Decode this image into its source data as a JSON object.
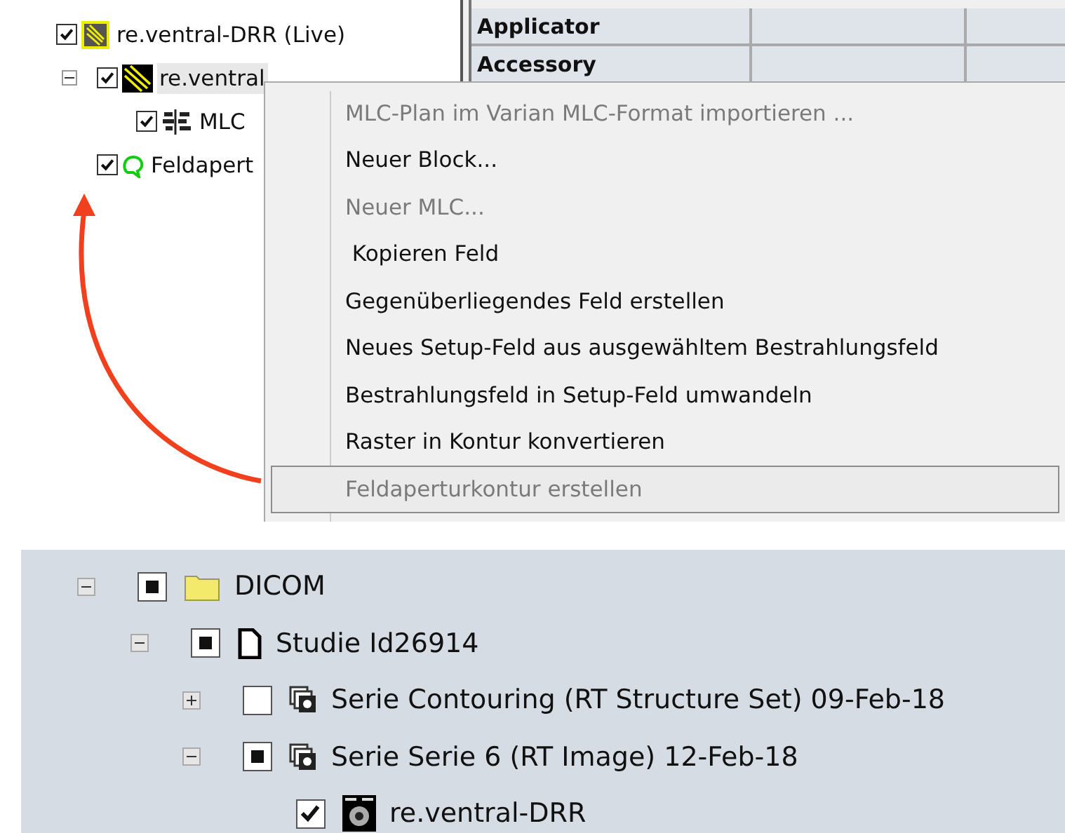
{
  "field_tree": [
    {
      "label": "re.ventral-DRR (Live)",
      "kind": "drr",
      "checked": true,
      "selected": false,
      "children": [
        {
          "label": "re.ventral",
          "kind": "field",
          "checked": true,
          "selected": true,
          "expanded": true,
          "children": [
            {
              "label": "MLC",
              "kind": "mlc",
              "checked": true,
              "selected": false
            }
          ]
        },
        {
          "label": "Feldapert",
          "kind": "aperture",
          "checked": true,
          "selected": false
        }
      ]
    }
  ],
  "properties_grid": {
    "rows": [
      {
        "label": "Applicator"
      },
      {
        "label": "Accessory"
      }
    ]
  },
  "context_menu": {
    "items": [
      {
        "label": "MLC-Plan im Varian MLC-Format importieren ...",
        "disabled": true,
        "selected": false
      },
      {
        "label": "Neuer Block...",
        "disabled": false,
        "selected": false
      },
      {
        "label": "Neuer MLC...",
        "disabled": true,
        "selected": false
      },
      {
        "label": " Kopieren Feld",
        "disabled": false,
        "selected": false
      },
      {
        "label": "Gegenüberliegendes Feld erstellen",
        "disabled": false,
        "selected": false
      },
      {
        "label": "Neues Setup-Feld aus ausgewähltem Bestrahlungsfeld",
        "disabled": false,
        "selected": false
      },
      {
        "label": "Bestrahlungsfeld in Setup-Feld umwandeln",
        "disabled": false,
        "selected": false
      },
      {
        "label": "Raster in Kontur konvertieren",
        "disabled": false,
        "selected": false
      },
      {
        "label": "Feldaperturkontur erstellen",
        "disabled": true,
        "selected": true
      }
    ]
  },
  "dicom_tree": [
    {
      "label": "DICOM",
      "kind": "folder",
      "checked": true,
      "indeterminate": true,
      "expanded": true,
      "children": [
        {
          "label": "Studie Id26914",
          "kind": "study",
          "checked": true,
          "indeterminate": true,
          "expanded": true,
          "children": [
            {
              "label": "Serie Contouring (RT Structure Set) 09-Feb-18",
              "kind": "series",
              "checked": false,
              "indeterminate": false,
              "expanded": false
            },
            {
              "label": "Serie Serie 6 (RT Image) 12-Feb-18",
              "kind": "series",
              "checked": true,
              "indeterminate": true,
              "expanded": true,
              "children": [
                {
                  "label": "re.ventral-DRR",
                  "kind": "image",
                  "checked": true,
                  "indeterminate": false
                }
              ]
            }
          ]
        }
      ]
    }
  ]
}
